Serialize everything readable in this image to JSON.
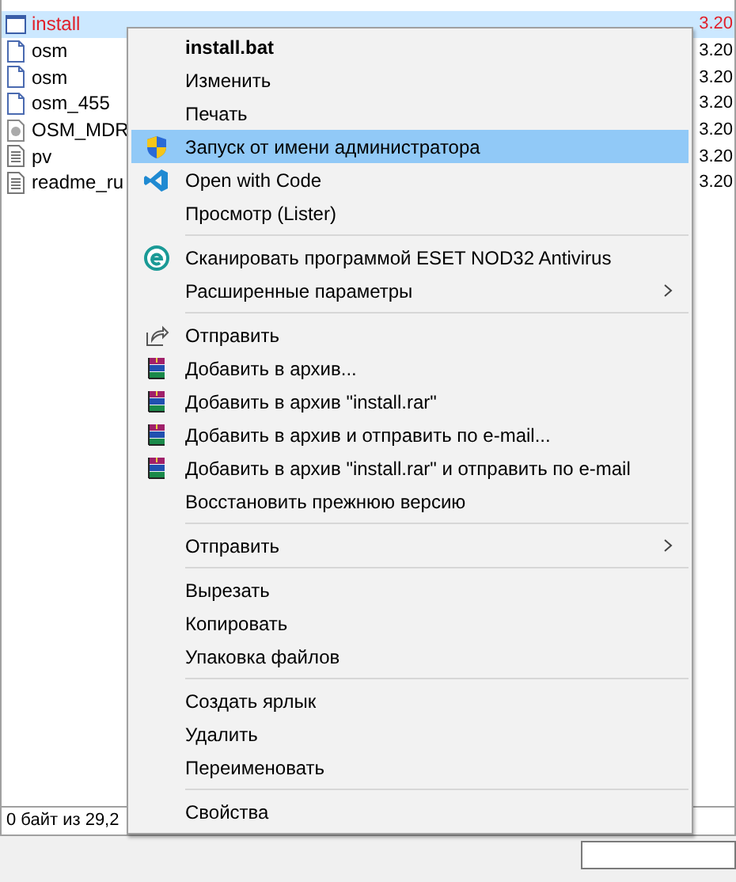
{
  "file_panel": {
    "rows": [
      {
        "name": "install",
        "kind": "batch",
        "selected": true,
        "date": "3.20"
      },
      {
        "name": "osm",
        "kind": "document",
        "selected": false,
        "date": "3.20"
      },
      {
        "name": "osm",
        "kind": "document",
        "selected": false,
        "date": "3.20"
      },
      {
        "name": "osm_455",
        "kind": "document",
        "selected": false,
        "date": "3.20"
      },
      {
        "name": "OSM_MDR",
        "kind": "disc",
        "selected": false,
        "date": "3.20"
      },
      {
        "name": "pv",
        "kind": "text",
        "selected": false,
        "date": "3.20"
      },
      {
        "name": "readme_ru",
        "kind": "text",
        "selected": false,
        "date": "3.20"
      }
    ],
    "status_bar": "0 байт из 29,2"
  },
  "context_menu": [
    {
      "kind": "header",
      "label": "install.bat"
    },
    {
      "kind": "plain",
      "label": "Изменить",
      "selected": false
    },
    {
      "kind": "plain",
      "label": "Печать",
      "selected": false
    },
    {
      "kind": "shield",
      "label": "Запуск от имени администратора",
      "selected": true
    },
    {
      "kind": "code",
      "label": "Open with Code",
      "selected": false
    },
    {
      "kind": "plain",
      "label": "Просмотр (Lister)",
      "selected": false
    },
    {
      "kind": "separator"
    },
    {
      "kind": "scan",
      "label": "Сканировать программой ESET NOD32 Antivirus",
      "selected": false
    },
    {
      "kind": "submenu",
      "label": "Расширенные параметры",
      "selected": false
    },
    {
      "kind": "separator"
    },
    {
      "kind": "share",
      "label": "Отправить",
      "selected": false
    },
    {
      "kind": "archive",
      "label": "Добавить в архив...",
      "selected": false
    },
    {
      "kind": "archive",
      "label": "Добавить в архив \"install.rar\"",
      "selected": false
    },
    {
      "kind": "archive",
      "label": "Добавить в архив и отправить по e-mail...",
      "selected": false
    },
    {
      "kind": "archive",
      "label": "Добавить в архив \"install.rar\" и отправить по e-mail",
      "selected": false
    },
    {
      "kind": "plain",
      "label": "Восстановить прежнюю версию",
      "selected": false
    },
    {
      "kind": "separator"
    },
    {
      "kind": "submenu",
      "label": "Отправить",
      "selected": false
    },
    {
      "kind": "separator"
    },
    {
      "kind": "plain",
      "label": "Вырезать",
      "selected": false
    },
    {
      "kind": "plain",
      "label": "Копировать",
      "selected": false
    },
    {
      "kind": "plain",
      "label": "Упаковка файлов",
      "selected": false
    },
    {
      "kind": "separator"
    },
    {
      "kind": "plain",
      "label": "Создать ярлык",
      "selected": false
    },
    {
      "kind": "plain",
      "label": "Удалить",
      "selected": false
    },
    {
      "kind": "plain",
      "label": "Переименовать",
      "selected": false
    },
    {
      "kind": "separator"
    },
    {
      "kind": "plain",
      "label": "Свойства",
      "selected": false
    }
  ]
}
